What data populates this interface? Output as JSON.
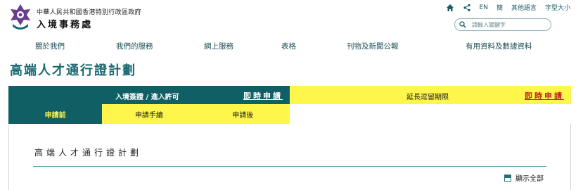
{
  "header": {
    "org_name": "中華人民共和國香港特別行政區政府",
    "dept_name": "入境事務處",
    "toplinks": {
      "lang_en": "EN",
      "lang_simplified": "簡",
      "other_languages": "其他語言",
      "font_size": "字型大小"
    },
    "search": {
      "placeholder": "請輸入關鍵字"
    }
  },
  "nav": {
    "items": [
      "關於我們",
      "我們的服務",
      "網上服務",
      "表格",
      "刊物及新聞公報",
      "有用資料及數據資料"
    ]
  },
  "page": {
    "title": "高端人才通行證計劃"
  },
  "tabs": {
    "primary_label": "入境簽證 / 進入許可",
    "primary_apply": "即時申請",
    "secondary_label": "延長逗留期限",
    "secondary_apply": "即時申請",
    "subtabs": [
      "申請前",
      "申請手續",
      "申請後"
    ]
  },
  "content": {
    "heading": "高端人才通行證計劃",
    "show_all": "顯示全部"
  },
  "colors": {
    "primary": "#0f5f64",
    "accent_yellow": "#fff64c",
    "apply_red": "#c91f1f",
    "title_teal": "#1b6a73"
  },
  "icons": {
    "home": "home-icon",
    "share": "share-icon",
    "search": "search-icon",
    "logo": "hk-emblem-icon"
  }
}
